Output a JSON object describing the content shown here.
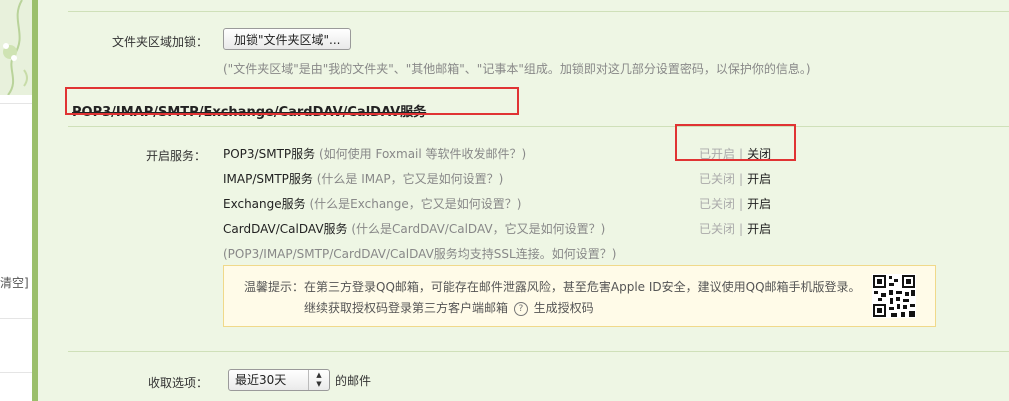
{
  "left": {
    "partial_text": "清空]"
  },
  "folder_lock": {
    "label": "文件夹区域加锁：",
    "button": "加锁\"文件夹区域\"...",
    "hint": "(\"文件夹区域\"是由\"我的文件夹\"、\"其他邮箱\"、\"记事本\"组成。加锁即对这几部分设置密码，以保护你的信息。)"
  },
  "section_title": "POP3/IMAP/SMTP/Exchange/CardDAV/CalDAV服务",
  "services": {
    "label": "开启服务：",
    "items": [
      {
        "name": "POP3/SMTP服务",
        "help": "(如何使用 Foxmail 等软件收发邮件？)",
        "status_a": "已开启",
        "status_b": "关闭"
      },
      {
        "name": "IMAP/SMTP服务",
        "help": "(什么是 IMAP，它又是如何设置？)",
        "status_a": "已关闭",
        "status_b": "开启"
      },
      {
        "name": "Exchange服务",
        "help": "(什么是Exchange，它又是如何设置？)",
        "status_a": "已关闭",
        "status_b": "开启"
      },
      {
        "name": "CardDAV/CalDAV服务",
        "help": "(什么是CardDAV/CalDAV，它又是如何设置？)",
        "status_a": "已关闭",
        "status_b": "开启"
      }
    ],
    "ssl_note": "(POP3/IMAP/SMTP/CardDAV/CalDAV服务均支持SSL连接。如何设置？)"
  },
  "notice": {
    "line1": "温馨提示：在第三方登录QQ邮箱，可能存在邮件泄露风险，甚至危害Apple ID安全，建议使用QQ邮箱手机版登录。",
    "line2_text": "继续获取授权码登录第三方客户端邮箱",
    "help_glyph": "?",
    "link": "生成授权码"
  },
  "receive": {
    "label": "收取选项：",
    "selected": "最近30天",
    "suffix": "的邮件"
  },
  "colors": {
    "highlight": "#e03333",
    "panel_bg": "#eef6e4",
    "notice_bg": "#fffbe8"
  }
}
